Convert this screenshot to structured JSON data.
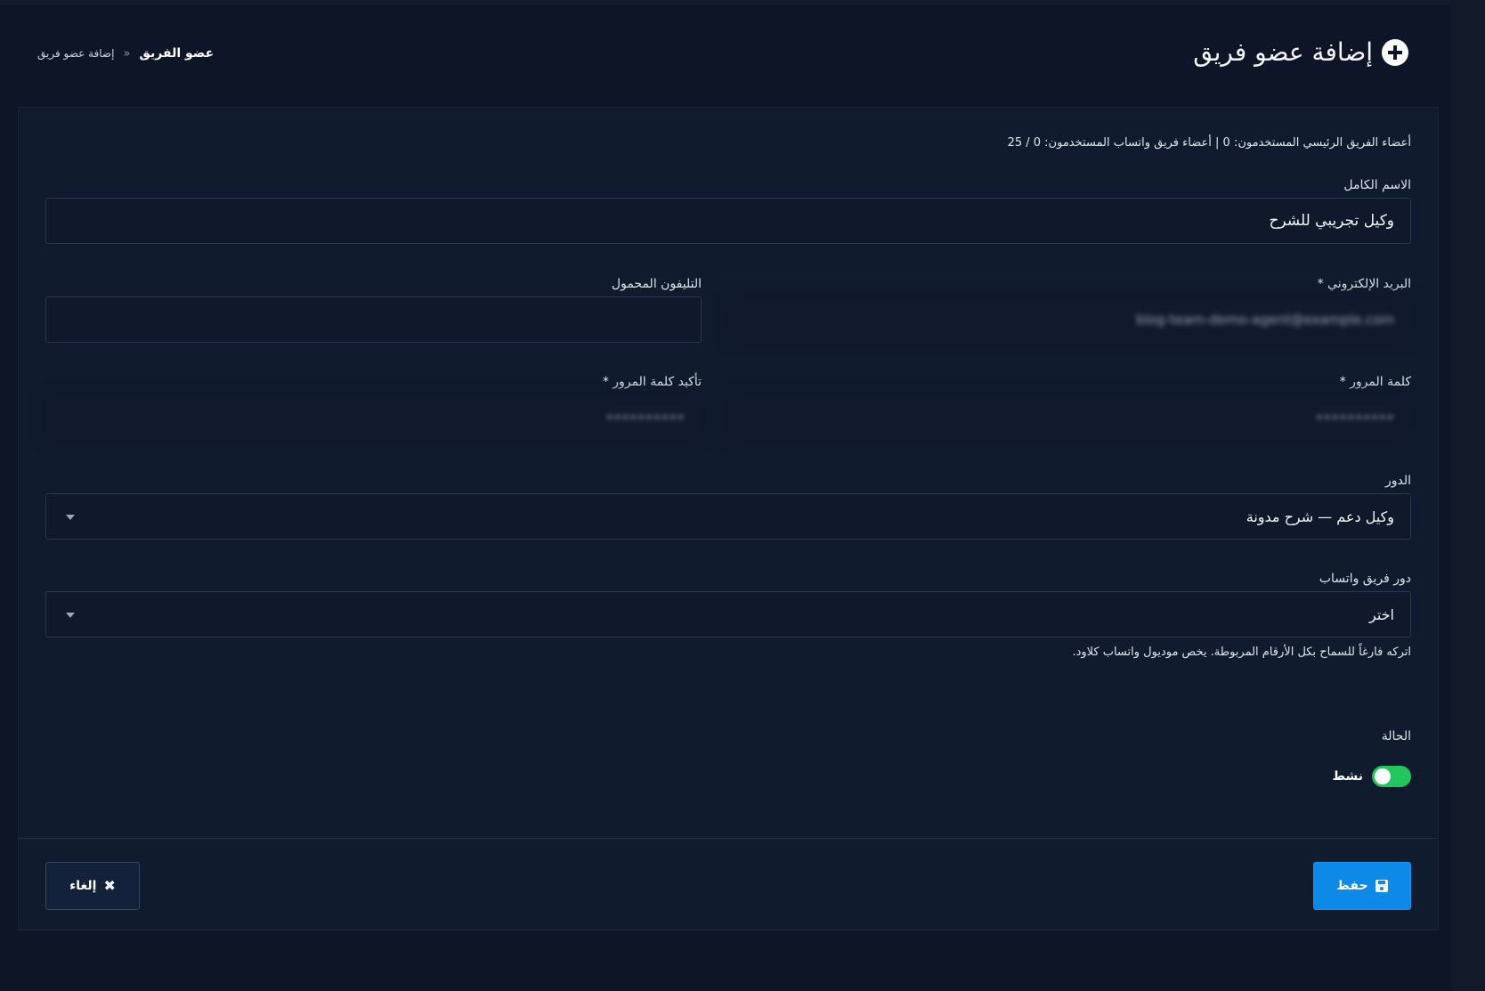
{
  "header": {
    "title": "إضافة عضو فريق",
    "breadcrumb": {
      "parent": "عضو الفريق",
      "separator": "»",
      "current": "إضافة عضو فريق"
    }
  },
  "form": {
    "usage_text": "أعضاء الفريق الرئيسي المستخدمون: 0  |  أعضاء فريق واتساب المستخدمون: 0 / 25",
    "full_name": {
      "label": "الاسم الكامل",
      "value": "وكيل تجريبي للشرح"
    },
    "email": {
      "label": "البريد الإلكتروني *",
      "value": "blog-team-demo-agent@example.com"
    },
    "mobile": {
      "label": "التليفون المحمول",
      "value": ""
    },
    "password": {
      "label": "كلمة المرور *",
      "value": "••••••••••"
    },
    "confirm_password": {
      "label": "تأكيد كلمة المرور *",
      "value": "••••••••••"
    },
    "role": {
      "label": "الدور",
      "value": "وكيل دعم — شرح مدونة"
    },
    "whatsapp_role": {
      "label": "دور فريق واتساب",
      "value": "اختر",
      "hint": "اتركه فارغاً للسماح بكل الأرقام المربوطة. يخص موديول واتساب كلاود."
    },
    "status": {
      "label": "الحالة",
      "toggle_label": "نشط",
      "on": true
    }
  },
  "actions": {
    "save_label": "حفظ",
    "cancel_label": "إلغاء"
  },
  "colors": {
    "primary": "#0d8ae8",
    "toggle_on": "#22c55e",
    "background": "#0d1526"
  }
}
